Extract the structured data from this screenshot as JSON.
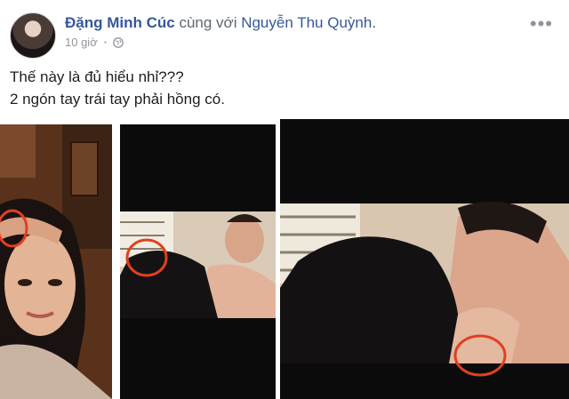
{
  "post": {
    "author": "Đặng Minh Cúc",
    "with_text": "cùng với",
    "tagged": "Nguyễn Thu Quỳnh.",
    "time": "10 giờ",
    "separator": "·",
    "privacy_icon": "globe-icon",
    "more_icon": "more-options-icon",
    "more_label": "•••",
    "text_lines": [
      "Thế này là đủ hiểu nhỉ???",
      "2 ngón tay trái tay phải hồng có."
    ]
  },
  "colors": {
    "link": "#365899",
    "meta": "#90949c",
    "text": "#1c1e21",
    "highlight_circle": "#e0401f"
  }
}
